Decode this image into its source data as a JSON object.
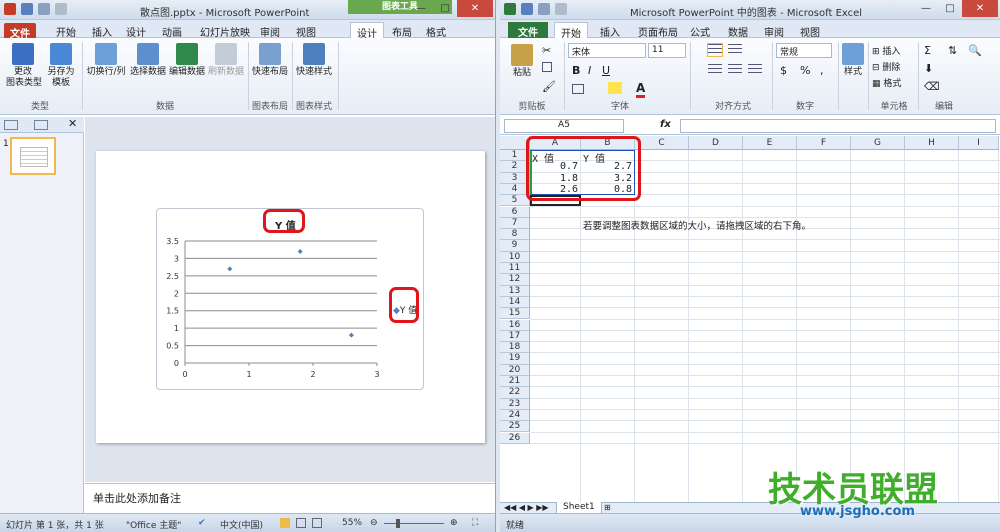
{
  "ppt": {
    "title": "散点图.pptx - Microsoft PowerPoint",
    "chart_tools_label": "图表工具",
    "tabs": [
      "文件",
      "开始",
      "插入",
      "设计",
      "动画",
      "幻灯片放映",
      "审阅",
      "视图",
      "设计",
      "布局",
      "格式"
    ],
    "ribbon_buttons": [
      {
        "label": "更改\n图表类型",
        "icon_color": "#3a6fc4"
      },
      {
        "label": "另存为\n模板",
        "icon_color": "#4b88d6"
      },
      {
        "label": "切换行/列",
        "icon_color": "#6f9fd8"
      },
      {
        "label": "选择数据",
        "icon_color": "#5d8fcf"
      },
      {
        "label": "编辑数据",
        "icon_color": "#2d8a4a"
      },
      {
        "label": "刷新数据",
        "icon_color": "#a9b6c4"
      },
      {
        "label": "快速布局",
        "icon_color": "#7aa0d0"
      },
      {
        "label": "快速样式",
        "icon_color": "#4f7fbf"
      }
    ],
    "groups": [
      "类型",
      "数据",
      "图表布局",
      "图表样式"
    ],
    "thumb_number": "1",
    "notes_placeholder": "单击此处添加备注",
    "status": {
      "slide_info": "幻灯片 第 1 张，共 1 张",
      "theme": "\"Office 主题\"",
      "language": "中文(中国)",
      "zoom": "55%"
    }
  },
  "chart_data": {
    "type": "scatter",
    "title": "Y 值",
    "legend": "Y 值",
    "legend_position": "right",
    "x": [
      0.7,
      1.8,
      2.6
    ],
    "y": [
      2.7,
      3.2,
      0.8
    ],
    "xlim": [
      0,
      3
    ],
    "ylim": [
      0,
      3.5
    ],
    "x_ticks": [
      "0",
      "1",
      "2",
      "3"
    ],
    "y_ticks": [
      "0",
      "0.5",
      "1",
      "1.5",
      "2",
      "2.5",
      "3",
      "3.5"
    ],
    "grid": true,
    "marker_color": "#4f81bd"
  },
  "excel": {
    "title": "Microsoft PowerPoint 中的图表 - Microsoft Excel",
    "tabs": [
      "文件",
      "开始",
      "插入",
      "页面布局",
      "公式",
      "数据",
      "审阅",
      "视图"
    ],
    "font_name": "宋体",
    "font_size": "11",
    "number_format": "常规",
    "ribbon_labels": {
      "paste": "粘贴",
      "style": "样式",
      "insert": "插入",
      "delete": "删除",
      "format": "格式"
    },
    "groups": [
      "剪贴板",
      "字体",
      "对齐方式",
      "数字",
      "单元格",
      "编辑"
    ],
    "name_box": "A5",
    "fx": "fx",
    "columns": [
      "A",
      "B",
      "C",
      "D",
      "E",
      "F",
      "G",
      "H",
      "I"
    ],
    "rows": [
      "1",
      "2",
      "3",
      "4",
      "5",
      "6",
      "7",
      "8",
      "9",
      "10",
      "11",
      "12",
      "13",
      "14",
      "15",
      "16",
      "17",
      "18",
      "19",
      "20",
      "21",
      "22",
      "23",
      "24",
      "25",
      "26"
    ],
    "cells": {
      "A1": "X 值",
      "B1": "Y 值",
      "A2": "0.7",
      "B2": "2.7",
      "A3": "1.8",
      "B3": "3.2",
      "A4": "2.6",
      "B4": "0.8"
    },
    "hint": "若要调整图表数据区域的大小，请拖拽区域的右下角。",
    "sheet_tab": "Sheet1",
    "status": "就绪"
  },
  "watermark": {
    "brand": "技术员联盟",
    "url": "www.jsgho.com"
  }
}
